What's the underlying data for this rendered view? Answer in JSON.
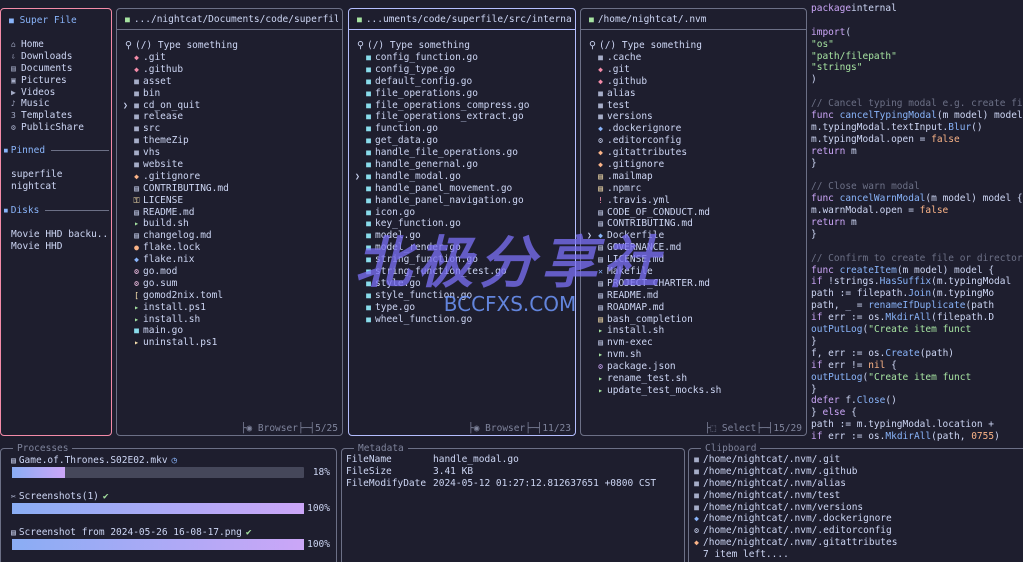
{
  "sidebar": {
    "title": "Super File",
    "well_known": [
      {
        "icon": "⌂",
        "label": "Home"
      },
      {
        "icon": "⇩",
        "label": "Downloads"
      },
      {
        "icon": "▤",
        "label": "Documents"
      },
      {
        "icon": "▣",
        "label": "Pictures"
      },
      {
        "icon": "▶",
        "label": "Videos"
      },
      {
        "icon": "♪",
        "label": "Music"
      },
      {
        "icon": "3",
        "label": "Templates"
      },
      {
        "icon": "⚙",
        "label": "PublicShare"
      }
    ],
    "pinned_title": "Pinned",
    "pinned": [
      "superfile",
      "nightcat"
    ],
    "disks_title": "Disks",
    "disks": [
      "Movie HHD backu...",
      "Movie HHD"
    ]
  },
  "panels": [
    {
      "path": ".../nightcat/Documents/code/superfile",
      "search_placeholder": "(/) Type something",
      "mode": "Browser",
      "position": "5/25",
      "selected": 4,
      "files": [
        {
          "icon": "◆",
          "color": "#f38ba8",
          "name": ".git"
        },
        {
          "icon": "◆",
          "color": "#f38ba8",
          "name": ".github"
        },
        {
          "icon": "■",
          "color": "#a6adc8",
          "name": "asset"
        },
        {
          "icon": "■",
          "color": "#a6adc8",
          "name": "bin"
        },
        {
          "icon": "■",
          "color": "#a6adc8",
          "name": "cd_on_quit"
        },
        {
          "icon": "■",
          "color": "#a6adc8",
          "name": "release"
        },
        {
          "icon": "■",
          "color": "#a6adc8",
          "name": "src"
        },
        {
          "icon": "■",
          "color": "#a6adc8",
          "name": "themeZip"
        },
        {
          "icon": "■",
          "color": "#a6adc8",
          "name": "vhs"
        },
        {
          "icon": "■",
          "color": "#a6adc8",
          "name": "website"
        },
        {
          "icon": "◆",
          "color": "#fab387",
          "name": ".gitignore"
        },
        {
          "icon": "▤",
          "color": "#cdd6f4",
          "name": "CONTRIBUTING.md"
        },
        {
          "icon": "⚿",
          "color": "#f9e2af",
          "name": "LICENSE"
        },
        {
          "icon": "▤",
          "color": "#cdd6f4",
          "name": "README.md"
        },
        {
          "icon": "▸",
          "color": "#a6e3a1",
          "name": "build.sh"
        },
        {
          "icon": "▤",
          "color": "#cdd6f4",
          "name": "changelog.md"
        },
        {
          "icon": "●",
          "color": "#fab387",
          "name": "flake.lock"
        },
        {
          "icon": "◆",
          "color": "#89b4fa",
          "name": "flake.nix"
        },
        {
          "icon": "⚙",
          "color": "#f5c2e7",
          "name": "go.mod"
        },
        {
          "icon": "⚙",
          "color": "#f5c2e7",
          "name": "go.sum"
        },
        {
          "icon": "[",
          "color": "#f9e2af",
          "name": "gomod2nix.toml"
        },
        {
          "icon": "▸",
          "color": "#a6e3a1",
          "name": "install.ps1"
        },
        {
          "icon": "▸",
          "color": "#a6e3a1",
          "name": "install.sh"
        },
        {
          "icon": "■",
          "color": "#89dceb",
          "name": "main.go"
        },
        {
          "icon": "▸",
          "color": "#f9e2af",
          "name": "uninstall.ps1"
        }
      ]
    },
    {
      "path": "...uments/code/superfile/src/internal",
      "search_placeholder": "(/) Type something",
      "mode": "Browser",
      "position": "11/23",
      "selected": 10,
      "files": [
        {
          "icon": "■",
          "color": "#89dceb",
          "name": "config_function.go"
        },
        {
          "icon": "■",
          "color": "#89dceb",
          "name": "config_type.go"
        },
        {
          "icon": "■",
          "color": "#89dceb",
          "name": "default_config.go"
        },
        {
          "icon": "■",
          "color": "#89dceb",
          "name": "file_operations.go"
        },
        {
          "icon": "■",
          "color": "#89dceb",
          "name": "file_operations_compress.go"
        },
        {
          "icon": "■",
          "color": "#89dceb",
          "name": "file_operations_extract.go"
        },
        {
          "icon": "■",
          "color": "#89dceb",
          "name": "function.go"
        },
        {
          "icon": "■",
          "color": "#89dceb",
          "name": "get_data.go"
        },
        {
          "icon": "■",
          "color": "#89dceb",
          "name": "handle_file_operations.go"
        },
        {
          "icon": "■",
          "color": "#89dceb",
          "name": "handle_genernal.go"
        },
        {
          "icon": "■",
          "color": "#89dceb",
          "name": "handle_modal.go"
        },
        {
          "icon": "■",
          "color": "#89dceb",
          "name": "handle_panel_movement.go"
        },
        {
          "icon": "■",
          "color": "#89dceb",
          "name": "handle_panel_navigation.go"
        },
        {
          "icon": "■",
          "color": "#89dceb",
          "name": "icon.go"
        },
        {
          "icon": "■",
          "color": "#89dceb",
          "name": "key_function.go"
        },
        {
          "icon": "■",
          "color": "#89dceb",
          "name": "model.go"
        },
        {
          "icon": "■",
          "color": "#89dceb",
          "name": "model_render.go"
        },
        {
          "icon": "■",
          "color": "#89dceb",
          "name": "string_function.go"
        },
        {
          "icon": "■",
          "color": "#89dceb",
          "name": "string_function_test.go"
        },
        {
          "icon": "■",
          "color": "#89dceb",
          "name": "style.go"
        },
        {
          "icon": "■",
          "color": "#89dceb",
          "name": "style_function.go"
        },
        {
          "icon": "■",
          "color": "#89dceb",
          "name": "type.go"
        },
        {
          "icon": "■",
          "color": "#89dceb",
          "name": "wheel_function.go"
        }
      ]
    },
    {
      "path": "/home/nightcat/.nvm",
      "search_placeholder": "(/) Type something",
      "mode": "Select",
      "position": "15/29",
      "selected": 15,
      "files": [
        {
          "icon": "■",
          "color": "#a6adc8",
          "name": ".cache"
        },
        {
          "icon": "◆",
          "color": "#f38ba8",
          "name": ".git"
        },
        {
          "icon": "◆",
          "color": "#f38ba8",
          "name": ".github"
        },
        {
          "icon": "■",
          "color": "#a6adc8",
          "name": "alias"
        },
        {
          "icon": "■",
          "color": "#a6adc8",
          "name": "test"
        },
        {
          "icon": "■",
          "color": "#a6adc8",
          "name": "versions"
        },
        {
          "icon": "◆",
          "color": "#89b4fa",
          "name": ".dockerignore"
        },
        {
          "icon": "⚙",
          "color": "#cdd6f4",
          "name": ".editorconfig"
        },
        {
          "icon": "◆",
          "color": "#fab387",
          "name": ".gitattributes"
        },
        {
          "icon": "◆",
          "color": "#fab387",
          "name": ".gitignore"
        },
        {
          "icon": "▤",
          "color": "#f9e2af",
          "name": ".mailmap"
        },
        {
          "icon": "▤",
          "color": "#f9e2af",
          "name": ".npmrc"
        },
        {
          "icon": "!",
          "color": "#f38ba8",
          "name": ".travis.yml"
        },
        {
          "icon": "▤",
          "color": "#cdd6f4",
          "name": "CODE_OF_CONDUCT.md"
        },
        {
          "icon": "▤",
          "color": "#cdd6f4",
          "name": "CONTRIBUTING.md"
        },
        {
          "icon": "◆",
          "color": "#89b4fa",
          "name": "Dockerfile"
        },
        {
          "icon": "▤",
          "color": "#cdd6f4",
          "name": "GOVERNANCE.md"
        },
        {
          "icon": "▤",
          "color": "#cdd6f4",
          "name": "LICENSE.md"
        },
        {
          "icon": "✕",
          "color": "#89b4fa",
          "name": "Makefile"
        },
        {
          "icon": "▤",
          "color": "#cdd6f4",
          "name": "PROJECT_CHARTER.md"
        },
        {
          "icon": "▤",
          "color": "#cdd6f4",
          "name": "README.md"
        },
        {
          "icon": "▤",
          "color": "#cdd6f4",
          "name": "ROADMAP.md"
        },
        {
          "icon": "▤",
          "color": "#f9e2af",
          "name": "bash_completion"
        },
        {
          "icon": "▸",
          "color": "#a6e3a1",
          "name": "install.sh"
        },
        {
          "icon": "▤",
          "color": "#cdd6f4",
          "name": "nvm-exec"
        },
        {
          "icon": "▸",
          "color": "#a6e3a1",
          "name": "nvm.sh"
        },
        {
          "icon": "⚙",
          "color": "#cba6f7",
          "name": "package.json"
        },
        {
          "icon": "▸",
          "color": "#a6e3a1",
          "name": "rename_test.sh"
        },
        {
          "icon": "▸",
          "color": "#a6e3a1",
          "name": "update_test_mocks.sh"
        }
      ]
    }
  ],
  "preview_lines": [
    [
      [
        "kw",
        "package"
      ],
      [
        "",
        "internal"
      ]
    ],
    [],
    [
      [
        "kw",
        "import"
      ],
      [
        "",
        "("
      ]
    ],
    [
      [
        "",
        "    "
      ],
      [
        "str",
        "\"os\""
      ]
    ],
    [
      [
        "",
        "    "
      ],
      [
        "str",
        "\"path/filepath\""
      ]
    ],
    [
      [
        "",
        "    "
      ],
      [
        "str",
        "\"strings\""
      ]
    ],
    [
      [
        "",
        ")"
      ]
    ],
    [],
    [
      [
        "cm",
        "// Cancel typing modal e.g. create file"
      ]
    ],
    [
      [
        "kw",
        "func "
      ],
      [
        "fn",
        "cancelTypingModal"
      ],
      [
        "",
        "(m model) model {"
      ]
    ],
    [
      [
        "",
        "    m.typingModal.textInput."
      ],
      [
        "fn",
        "Blur"
      ],
      [
        "",
        "()"
      ]
    ],
    [
      [
        "",
        "    m.typingModal.open = "
      ],
      [
        "nb",
        "false"
      ]
    ],
    [
      [
        "",
        "    "
      ],
      [
        "kw",
        "return"
      ],
      [
        "",
        " m"
      ]
    ],
    [
      [
        "",
        "}"
      ]
    ],
    [],
    [
      [
        "cm",
        "// Close warn modal"
      ]
    ],
    [
      [
        "kw",
        "func "
      ],
      [
        "fn",
        "cancelWarnModal"
      ],
      [
        "",
        "(m model) model {"
      ]
    ],
    [
      [
        "",
        "    m.warnModal.open = "
      ],
      [
        "nb",
        "false"
      ]
    ],
    [
      [
        "",
        "    "
      ],
      [
        "kw",
        "return"
      ],
      [
        "",
        " m"
      ]
    ],
    [
      [
        "",
        "}"
      ]
    ],
    [],
    [
      [
        "cm",
        "// Confirm to create file or directory"
      ]
    ],
    [
      [
        "kw",
        "func "
      ],
      [
        "fn",
        "createItem"
      ],
      [
        "",
        "(m model) model {"
      ]
    ],
    [
      [
        "",
        "    "
      ],
      [
        "kw",
        "if"
      ],
      [
        "",
        " !strings."
      ],
      [
        "fn",
        "HasSuffix"
      ],
      [
        "",
        "(m.typingModal"
      ]
    ],
    [
      [
        "",
        "        path := filepath."
      ],
      [
        "fn",
        "Join"
      ],
      [
        "",
        "(m.typingMo"
      ]
    ],
    [
      [
        "",
        "        path, _ = "
      ],
      [
        "fn",
        "renameIfDuplicate"
      ],
      [
        "",
        "(path"
      ]
    ],
    [
      [
        "",
        "        "
      ],
      [
        "kw",
        "if"
      ],
      [
        "",
        " err := os."
      ],
      [
        "fn",
        "MkdirAll"
      ],
      [
        "",
        "(filepath.D"
      ]
    ],
    [
      [
        "",
        "            "
      ],
      [
        "fn",
        "outPutLog"
      ],
      [
        "",
        "("
      ],
      [
        "str",
        "\"Create item funct"
      ]
    ],
    [
      [
        "",
        "        }"
      ]
    ],
    [
      [
        "",
        "        f, err := os."
      ],
      [
        "fn",
        "Create"
      ],
      [
        "",
        "(path)"
      ]
    ],
    [
      [
        "",
        "        "
      ],
      [
        "kw",
        "if"
      ],
      [
        "",
        " err != "
      ],
      [
        "nb",
        "nil"
      ],
      [
        "",
        " {"
      ]
    ],
    [
      [
        "",
        "            "
      ],
      [
        "fn",
        "outPutLog"
      ],
      [
        "",
        "("
      ],
      [
        "str",
        "\"Create item funct"
      ]
    ],
    [
      [
        "",
        "        }"
      ]
    ],
    [
      [
        "",
        "        "
      ],
      [
        "kw",
        "defer"
      ],
      [
        "",
        " f."
      ],
      [
        "fn",
        "Close"
      ],
      [
        "",
        "()"
      ]
    ],
    [
      [
        "",
        "    } "
      ],
      [
        "kw",
        "else"
      ],
      [
        "",
        " {"
      ]
    ],
    [
      [
        "",
        "        path := m.typingModal.location + "
      ]
    ],
    [
      [
        "",
        "        "
      ],
      [
        "kw",
        "if"
      ],
      [
        "",
        " err := os."
      ],
      [
        "fn",
        "MkdirAll"
      ],
      [
        "",
        "(path, "
      ],
      [
        "nb",
        "0755"
      ],
      [
        "",
        ")"
      ]
    ]
  ],
  "processes": {
    "title": "Processes",
    "items": [
      {
        "icon": "▤",
        "name": "Game.of.Thrones.S02E02.mkv",
        "status_icon": "◷",
        "status_color": "#89b4fa",
        "progress": 18,
        "label": "18%"
      },
      {
        "icon": "✂",
        "name": "Screenshots(1)",
        "status_icon": "✔",
        "status_color": "#a6e3a1",
        "progress": 100,
        "label": "100%"
      },
      {
        "icon": "▤",
        "name": "Screenshot from 2024-05-26 16-08-17.png",
        "status_icon": "✔",
        "status_color": "#a6e3a1",
        "progress": 100,
        "label": "100%"
      }
    ]
  },
  "metadata": {
    "title": "Metadata",
    "rows": [
      {
        "key": "FileName",
        "value": "handle_modal.go"
      },
      {
        "key": "FileSize",
        "value": "3.41 KB"
      },
      {
        "key": "FileModifyDate",
        "value": "2024-05-12 01:27:12.812637651 +0800 CST"
      }
    ]
  },
  "clipboard": {
    "title": "Clipboard",
    "items": [
      {
        "icon": "■",
        "color": "#a6adc8",
        "path": "/home/nightcat/.nvm/.git"
      },
      {
        "icon": "■",
        "color": "#a6adc8",
        "path": "/home/nightcat/.nvm/.github"
      },
      {
        "icon": "■",
        "color": "#a6adc8",
        "path": "/home/nightcat/.nvm/alias"
      },
      {
        "icon": "■",
        "color": "#a6adc8",
        "path": "/home/nightcat/.nvm/test"
      },
      {
        "icon": "■",
        "color": "#a6adc8",
        "path": "/home/nightcat/.nvm/versions"
      },
      {
        "icon": "◆",
        "color": "#89b4fa",
        "path": "/home/nightcat/.nvm/.dockerignore"
      },
      {
        "icon": "⚙",
        "color": "#cdd6f4",
        "path": "/home/nightcat/.nvm/.editorconfig"
      },
      {
        "icon": "◆",
        "color": "#fab387",
        "path": "/home/nightcat/.nvm/.gitattributes"
      }
    ],
    "more": "7 item left...."
  },
  "watermark": {
    "text": "北极分享社",
    "url": "BCCFXS.COM"
  }
}
